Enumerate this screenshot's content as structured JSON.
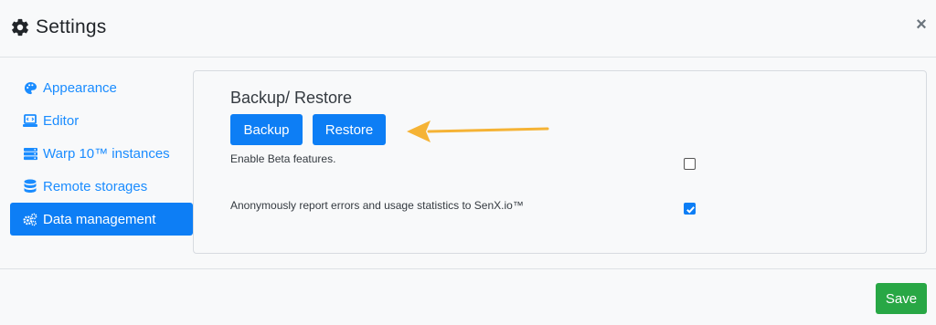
{
  "header": {
    "title": "Settings",
    "close_label": "×"
  },
  "sidebar": {
    "items": [
      {
        "label": "Appearance",
        "icon": "palette-icon",
        "active": false
      },
      {
        "label": "Editor",
        "icon": "laptop-code-icon",
        "active": false
      },
      {
        "label": "Warp 10™ instances",
        "icon": "server-icon",
        "active": false
      },
      {
        "label": "Remote storages",
        "icon": "database-icon",
        "active": false
      },
      {
        "label": "Data management",
        "icon": "cogs-icon",
        "active": true
      }
    ]
  },
  "main": {
    "section_title": "Backup/ Restore",
    "backup_label": "Backup",
    "restore_label": "Restore",
    "options": [
      {
        "label": "Enable Beta features.",
        "checked": false
      },
      {
        "label": "Anonymously report errors and usage statistics to SenX.io™",
        "checked": true
      }
    ],
    "annotation": "arrow-left-icon"
  },
  "footer": {
    "save_label": "Save"
  },
  "colors": {
    "primary": "#0d7ef5",
    "link": "#1a8cff",
    "success": "#28a745",
    "arrow": "#f5b335"
  }
}
